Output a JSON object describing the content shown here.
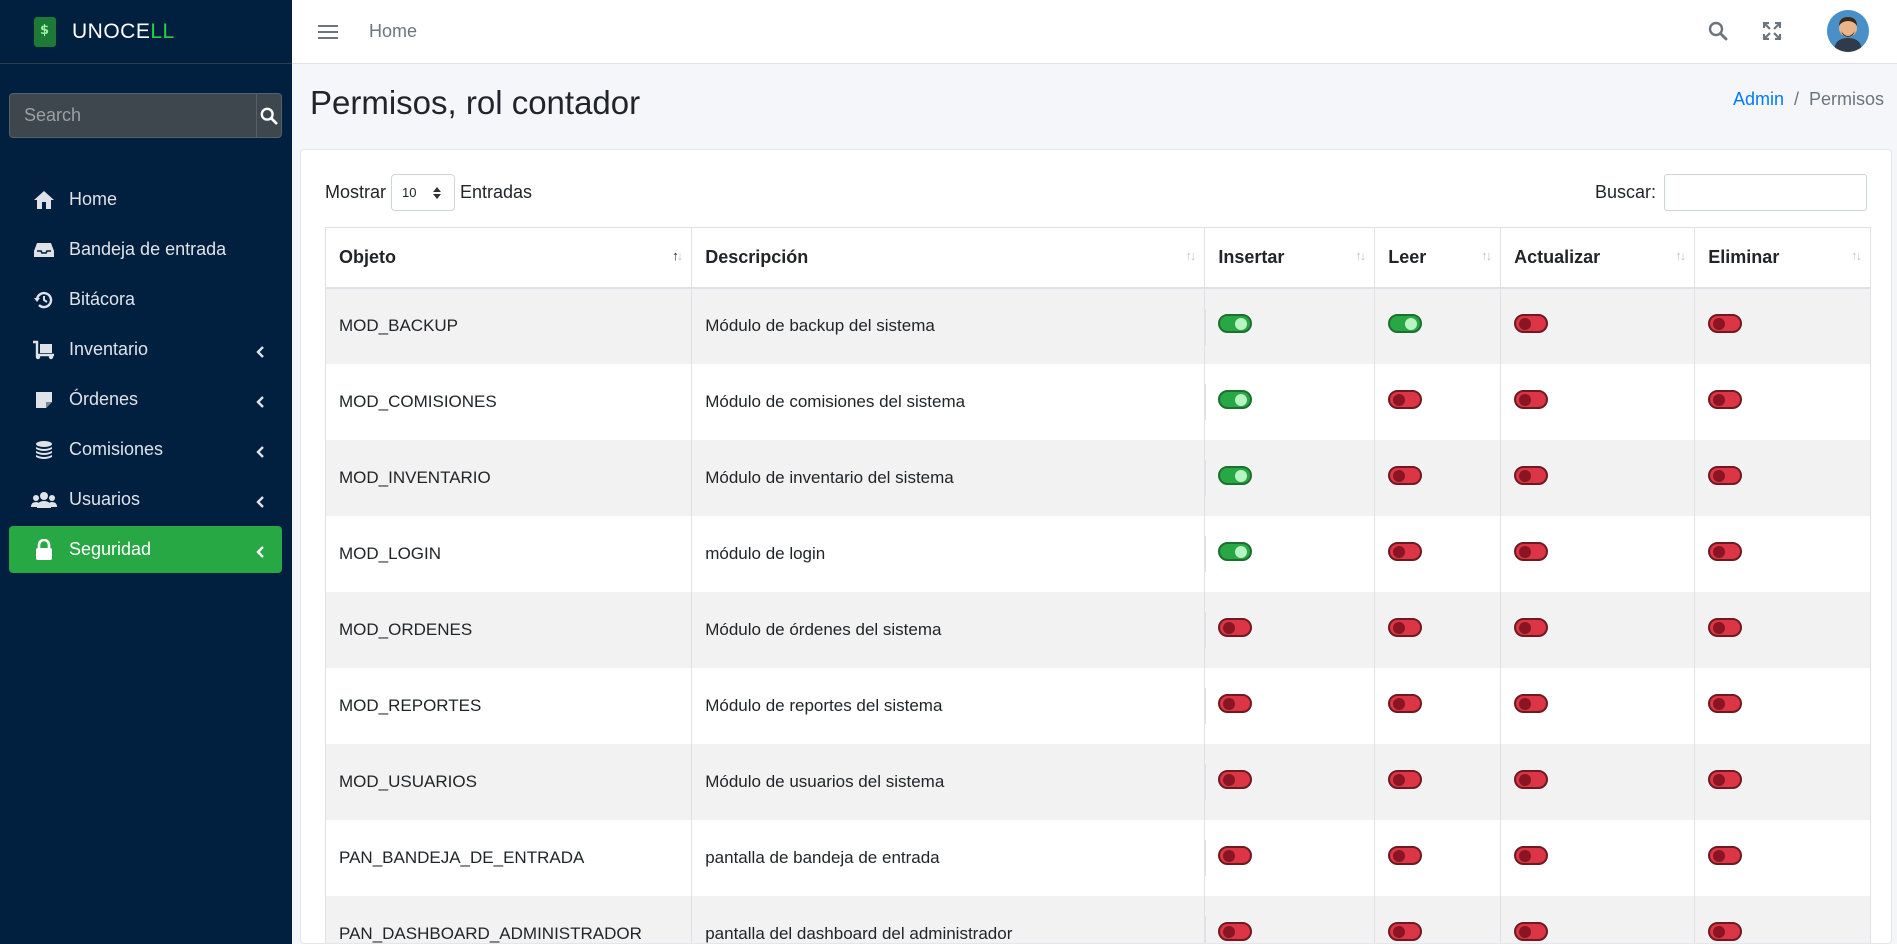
{
  "brand": {
    "name_main": "UNOCE",
    "name_accent": "LL"
  },
  "sidebar": {
    "search_placeholder": "Search",
    "items": [
      {
        "label": "Home",
        "icon": "home-icon"
      },
      {
        "label": "Bandeja de entrada",
        "icon": "inbox-icon"
      },
      {
        "label": "Bitácora",
        "icon": "history-icon"
      },
      {
        "label": "Inventario",
        "icon": "dolly-icon"
      },
      {
        "label": "Órdenes",
        "icon": "note-icon"
      },
      {
        "label": "Comisiones",
        "icon": "coins-icon"
      },
      {
        "label": "Usuarios",
        "icon": "users-icon"
      },
      {
        "label": "Seguridad",
        "icon": "lock-icon"
      }
    ]
  },
  "topbar": {
    "home": "Home"
  },
  "page": {
    "title": "Permisos, rol contador"
  },
  "breadcrumb": {
    "first": "Admin",
    "sep": "/",
    "current": "Permisos"
  },
  "table_controls": {
    "show_label": "Mostrar",
    "show_value": "10",
    "entries_label": "Entradas",
    "search_label": "Buscar:"
  },
  "table": {
    "headers": [
      "Objeto",
      "Descripción",
      "Insertar",
      "Leer",
      "Actualizar",
      "Eliminar"
    ],
    "rows": [
      {
        "objeto": "MOD_BACKUP",
        "descripcion": "Módulo de backup del sistema",
        "insertar": true,
        "leer": true,
        "actualizar": false,
        "eliminar": false
      },
      {
        "objeto": "MOD_COMISIONES",
        "descripcion": "Módulo de comisiones del sistema",
        "insertar": true,
        "leer": false,
        "actualizar": false,
        "eliminar": false
      },
      {
        "objeto": "MOD_INVENTARIO",
        "descripcion": "Módulo de inventario del sistema",
        "insertar": true,
        "leer": false,
        "actualizar": false,
        "eliminar": false
      },
      {
        "objeto": "MOD_LOGIN",
        "descripcion": "módulo de login",
        "insertar": true,
        "leer": false,
        "actualizar": false,
        "eliminar": false
      },
      {
        "objeto": "MOD_ORDENES",
        "descripcion": "Módulo de órdenes del sistema",
        "insertar": false,
        "leer": false,
        "actualizar": false,
        "eliminar": false
      },
      {
        "objeto": "MOD_REPORTES",
        "descripcion": "Módulo de reportes del sistema",
        "insertar": false,
        "leer": false,
        "actualizar": false,
        "eliminar": false
      },
      {
        "objeto": "MOD_USUARIOS",
        "descripcion": "Módulo de usuarios del sistema",
        "insertar": false,
        "leer": false,
        "actualizar": false,
        "eliminar": false
      },
      {
        "objeto": "PAN_BANDEJA_DE_ENTRADA",
        "descripcion": "pantalla de bandeja de entrada",
        "insertar": false,
        "leer": false,
        "actualizar": false,
        "eliminar": false
      },
      {
        "objeto": "PAN_DASHBOARD_ADMINISTRADOR",
        "descripcion": "pantalla del dashboard del administrador",
        "insertar": false,
        "leer": false,
        "actualizar": false,
        "eliminar": false
      }
    ]
  },
  "colors": {
    "sidebar_bg": "#011f3f",
    "active": "#28a745",
    "switch_on": "#28a745",
    "switch_off": "#dc3545",
    "link": "#007bff"
  }
}
